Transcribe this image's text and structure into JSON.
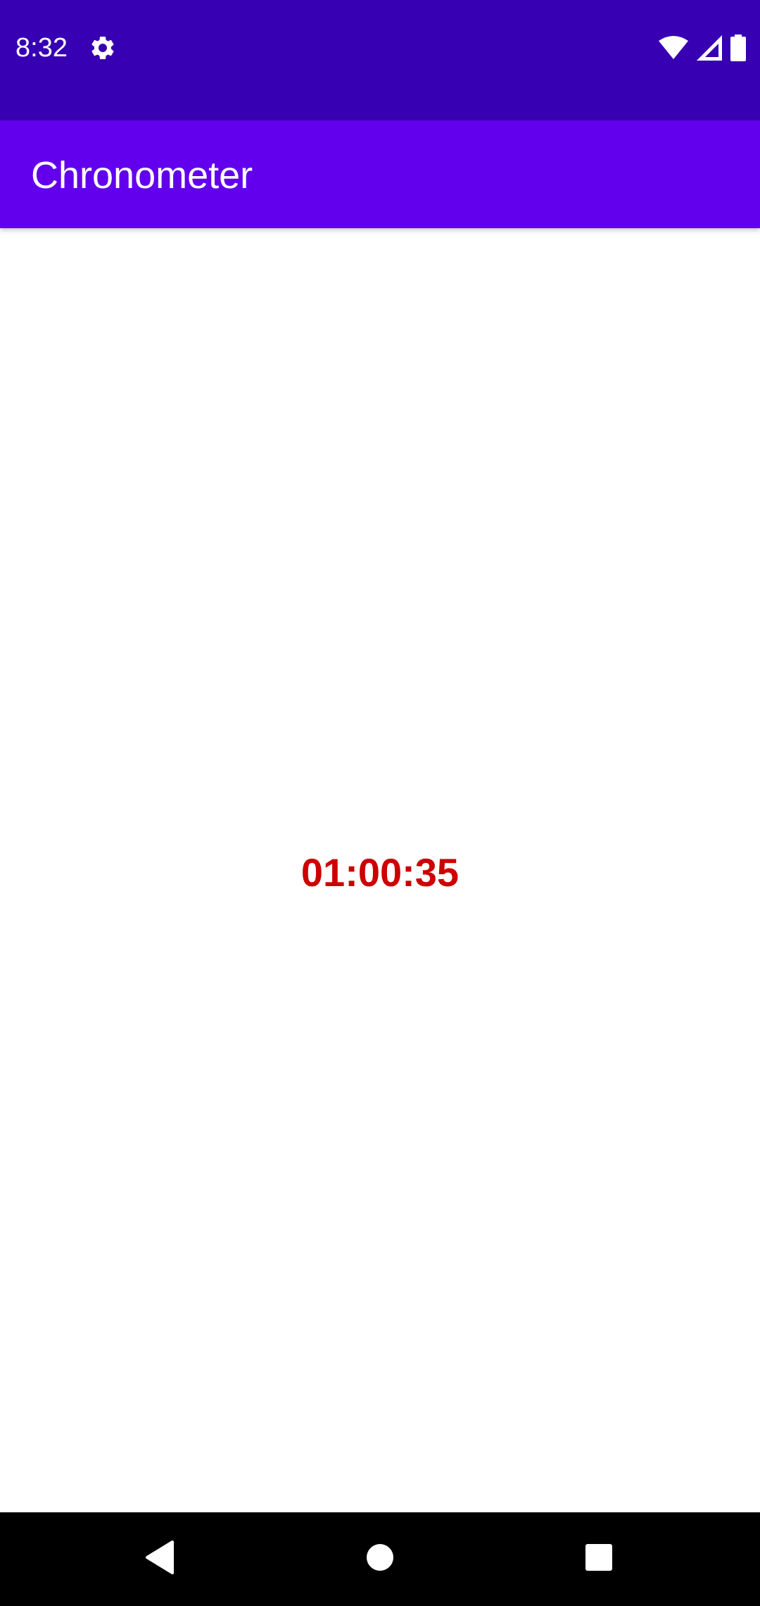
{
  "status_bar": {
    "time": "8:32",
    "icons": [
      "gear-icon",
      "wifi-icon",
      "cellular-signal-icon",
      "battery-icon"
    ],
    "background": "#3700b3"
  },
  "app_bar": {
    "title": "Chronometer",
    "background": "#6200ee"
  },
  "main": {
    "chronometer_value": "01:00:35",
    "chronometer_color": "#cc0000"
  },
  "nav_bar": {
    "icons": [
      "back-icon",
      "home-icon",
      "recents-icon"
    ]
  }
}
